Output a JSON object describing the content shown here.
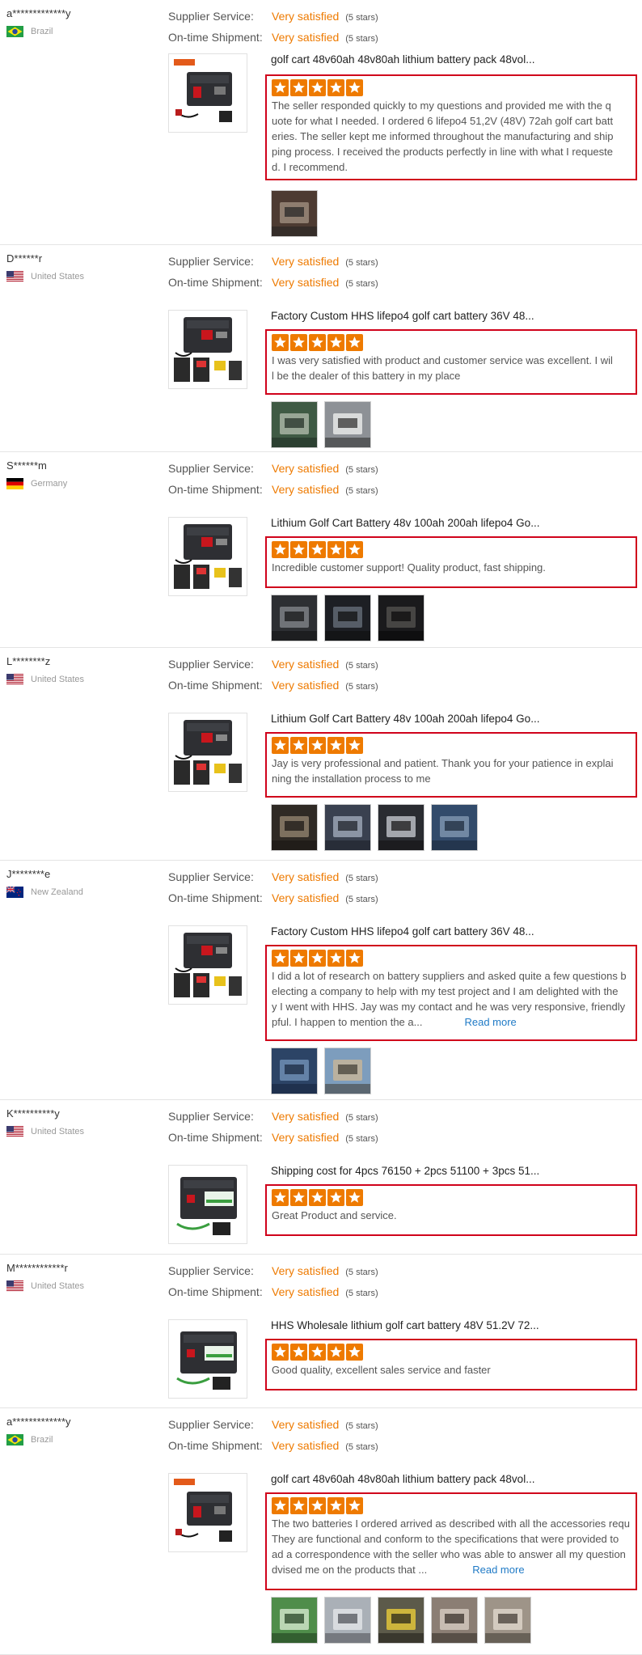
{
  "rating_labels": {
    "service": "Supplier Service:",
    "shipment": "On-time Shipment:"
  },
  "colors": {
    "accent": "#ee7a00",
    "highlight_border": "#d0021b",
    "link": "#1f7ac6"
  },
  "reviews": [
    {
      "name": "a*************y",
      "country": "Brazil",
      "flag": "brazil",
      "supplier_service": "Very satisfied",
      "supplier_service_stars": "(5 stars)",
      "on_time_shipment": "Very satisfied",
      "on_time_shipment_stars": "(5 stars)",
      "product_title": "golf cart 48v60ah 48v80ah lithium battery pack 48vol...",
      "product_thumb": "hhs-energy-battery",
      "rating": 5,
      "text_lines": [
        "The seller responded quickly to my questions and provided me with the q",
        "uote for what I needed. I ordered 6 lifepo4 51,2V (48V) 72ah golf cart batt",
        "eries. The seller kept me informed throughout the manufacturing and ship",
        "ping process. I received the products perfectly in line with what I requeste",
        "d. I recommend."
      ],
      "read_more": "",
      "photos": [
        "person-with-battery"
      ]
    },
    {
      "name": "D******r",
      "country": "United States",
      "flag": "usa",
      "supplier_service": "Very satisfied",
      "supplier_service_stars": "(5 stars)",
      "on_time_shipment": "Very satisfied",
      "on_time_shipment_stars": "(5 stars)",
      "product_title": "Factory Custom HHS lifepo4 golf cart battery 36V 48...",
      "product_thumb": "golf-cart-battery-kit",
      "rating": 5,
      "text_lines": [
        "I was very satisfied with product and customer service was excellent. I wil",
        "l be the dealer of this battery in my place"
      ],
      "read_more": "",
      "photos": [
        "golf-cart-green",
        "golf-cart-white"
      ]
    },
    {
      "name": "S******m",
      "country": "Germany",
      "flag": "germany",
      "supplier_service": "Very satisfied",
      "supplier_service_stars": "(5 stars)",
      "on_time_shipment": "Very satisfied",
      "on_time_shipment_stars": "(5 stars)",
      "product_title": "Lithium Golf Cart Battery 48v 100ah 200ah lifepo4 Go...",
      "product_thumb": "golf-cart-battery-kit",
      "rating": 5,
      "text_lines": [
        "Incredible customer support! Quality product, fast shipping."
      ],
      "read_more": "",
      "photos": [
        "battery-installed",
        "cart-interior",
        "battery-dark"
      ]
    },
    {
      "name": "L********z",
      "country": "United States",
      "flag": "usa",
      "supplier_service": "Very satisfied",
      "supplier_service_stars": "(5 stars)",
      "on_time_shipment": "Very satisfied",
      "on_time_shipment_stars": "(5 stars)",
      "product_title": "Lithium Golf Cart Battery 48v 100ah 200ah lifepo4 Go...",
      "product_thumb": "golf-cart-battery-kit",
      "rating": 5,
      "text_lines": [
        "Jay is very professional and patient. Thank you for your patience in explai",
        "ning the installation process to me"
      ],
      "read_more": "",
      "photos": [
        "battery-compartment",
        "battery-wiring",
        "battery-top",
        "battery-box-blue"
      ]
    },
    {
      "name": "J********e",
      "country": "New Zealand",
      "flag": "newzealand",
      "supplier_service": "Very satisfied",
      "supplier_service_stars": "(5 stars)",
      "on_time_shipment": "Very satisfied",
      "on_time_shipment_stars": "(5 stars)",
      "product_title": "Factory Custom HHS lifepo4 golf cart battery 36V 48...",
      "product_thumb": "golf-cart-battery-kit",
      "rating": 5,
      "text_lines": [
        "I did a lot of research on battery suppliers and asked quite a few questions b",
        "electing a company to help with my test project and I am delighted with the",
        "y I went with HHS. Jay was my contact and he was very responsive, friendly",
        "pful. I happen to mention the a..."
      ],
      "read_more": "Read more",
      "photos": [
        "battery-blue-box",
        "vehicle-outdoor"
      ]
    },
    {
      "name": "K**********y",
      "country": "United States",
      "flag": "usa",
      "supplier_service": "Very satisfied",
      "supplier_service_stars": "(5 stars)",
      "on_time_shipment": "Very satisfied",
      "on_time_shipment_stars": "(5 stars)",
      "product_title": "Shipping cost for 4pcs 76150 + 2pcs 51100 + 3pcs 51...",
      "product_thumb": "green-label-battery",
      "rating": 5,
      "text_lines": [
        "Great Product and service."
      ],
      "read_more": "",
      "photos": []
    },
    {
      "name": "M************r",
      "country": "United States",
      "flag": "usa",
      "supplier_service": "Very satisfied",
      "supplier_service_stars": "(5 stars)",
      "on_time_shipment": "Very satisfied",
      "on_time_shipment_stars": "(5 stars)",
      "product_title": "HHS Wholesale lithium golf cart battery 48V 51.2V 72...",
      "product_thumb": "green-label-battery",
      "rating": 5,
      "text_lines": [
        "Good quality, excellent sales service and faster"
      ],
      "read_more": "",
      "photos": []
    },
    {
      "name": "a*************y",
      "country": "Brazil",
      "flag": "brazil",
      "supplier_service": "Very satisfied",
      "supplier_service_stars": "(5 stars)",
      "on_time_shipment": "Very satisfied",
      "on_time_shipment_stars": "(5 stars)",
      "product_title": "golf cart 48v60ah 48v80ah lithium battery pack 48vol...",
      "product_thumb": "hhs-energy-battery",
      "rating": 5,
      "text_lines": [
        "The two batteries I ordered arrived as described with all the accessories requ",
        "They are functional and conform to the specifications that were provided to",
        "ad a correspondence with the seller who was able to answer all my question",
        "dvised me on the products that ..."
      ],
      "read_more": "Read more",
      "photos": [
        "battery-green-board",
        "battery-cells",
        "battery-yellow-tool",
        "battery-wire-hand",
        "battery-parts"
      ]
    }
  ]
}
